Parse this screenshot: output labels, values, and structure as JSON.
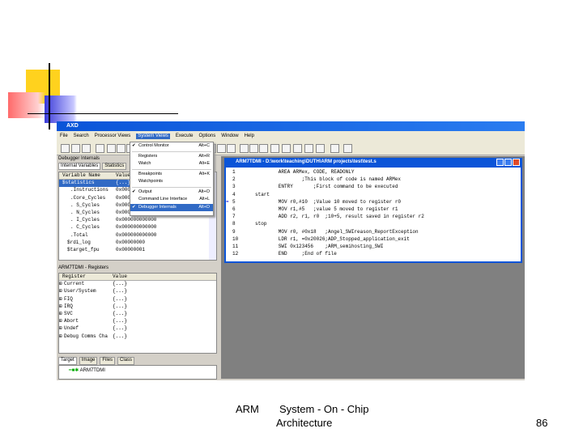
{
  "app_title": "AXD",
  "menu": [
    "File",
    "Search",
    "Processor Views",
    "System Views",
    "Execute",
    "Options",
    "Window",
    "Help"
  ],
  "system_views_menu": [
    {
      "label": "Control Monitor",
      "shortcut": "Alt+C",
      "checked": true
    },
    {
      "label": "Registers",
      "shortcut": "Alt+R"
    },
    {
      "label": "Watch",
      "shortcut": "Alt+E"
    },
    {
      "label": "Breakpoints",
      "shortcut": "Alt+K"
    },
    {
      "label": "Watchpoints",
      "shortcut": ""
    },
    {
      "label": "Output",
      "shortcut": "Alt+O",
      "checked": true
    },
    {
      "label": "Command Line Interface",
      "shortcut": "Alt+L"
    },
    {
      "label": "Debugger Internals",
      "shortcut": "Alt+D",
      "checked": true
    }
  ],
  "internals": {
    "title": "Debugger Internals",
    "tabs": [
      "Internal Variables",
      "Statistics"
    ],
    "headers": [
      "Variable Name",
      "Value"
    ],
    "rows": [
      [
        "$statistics",
        "{...}"
      ],
      [
        ".Instructions",
        "0x000"
      ],
      [
        ".Core_Cycles",
        "0x000"
      ],
      [
        ". S_Cycles",
        "0x000"
      ],
      [
        ". N_Cycles",
        "0x00000000000"
      ],
      [
        ". I_Cycles",
        "0x000000000000"
      ],
      [
        ". C_Cycles",
        "0x000000000000"
      ],
      [
        ".Total",
        "0x000000000000"
      ],
      [
        "$rdi_log",
        "0x00000000"
      ],
      [
        "$target_fpu",
        "0x00000001"
      ]
    ]
  },
  "registers": {
    "title": "ARM7TDMI - Registers",
    "headers": [
      "Register",
      "Value"
    ],
    "rows": [
      [
        "Current",
        "{...}"
      ],
      [
        "User/System",
        "{...}"
      ],
      [
        "FIQ",
        "{...}"
      ],
      [
        "IRQ",
        "{...}"
      ],
      [
        "SVC",
        "{...}"
      ],
      [
        "Abort",
        "{...}"
      ],
      [
        "Undef",
        "{...}"
      ],
      [
        "Debug Comms Cha",
        "{...}"
      ]
    ]
  },
  "target": {
    "tabs": [
      "Target",
      "Image",
      "Files",
      "Class"
    ],
    "item": "ARM7TDMI"
  },
  "code_window": {
    "title": "ARM7TDMI - D:\\work\\teaching\\DUTH\\ARM projects\\test\\test.s",
    "current_line": 5,
    "lines": [
      "        AREA ARMex, CODE, READONLY",
      "                ;This block of code is named ARMex",
      "        ENTRY       ;First command to be executed",
      "start",
      "        MOV r0,#10  ;Value 10 moved to register r0",
      "        MOV r1,#5   ;value 5 moved to register r1",
      "        ADD r2, r1, r0  ;10+5, result saved in register r2",
      "stop",
      "        MOV r0, #0x18   ;Angel_SWIreason_ReportException",
      "        LDR r1, =0x20026;ADP_Stopped_application_exit",
      "        SWI 0x123456    ;ARM_semihosting_SWI",
      "        END     ;End of file"
    ]
  },
  "footer": {
    "left": "ARM",
    "title_line1": "System - On - Chip",
    "title_line2": "Architecture",
    "page": "86"
  }
}
